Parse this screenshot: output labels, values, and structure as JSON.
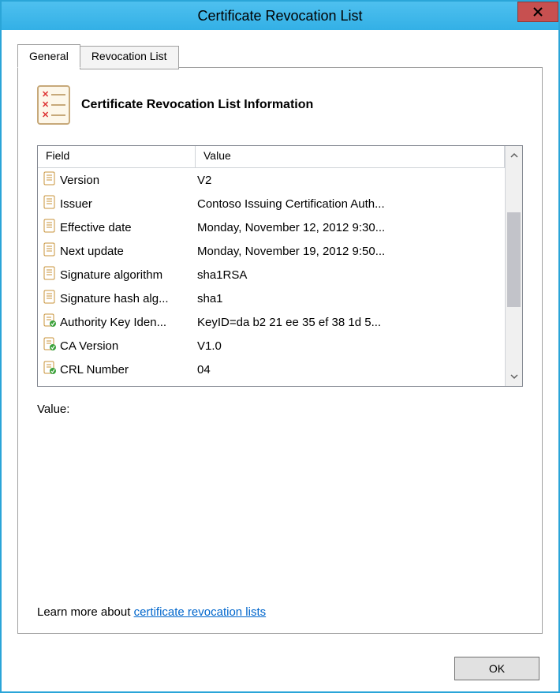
{
  "window": {
    "title": "Certificate Revocation List"
  },
  "tabs": {
    "general": "General",
    "revocation_list": "Revocation List"
  },
  "panel": {
    "title": "Certificate Revocation List Information",
    "columns": {
      "field": "Field",
      "value": "Value"
    },
    "rows": [
      {
        "icon": "doc",
        "field": "Version",
        "value": "V2"
      },
      {
        "icon": "doc",
        "field": "Issuer",
        "value": "Contoso Issuing Certification Auth..."
      },
      {
        "icon": "doc",
        "field": "Effective date",
        "value": "Monday, November 12, 2012 9:30..."
      },
      {
        "icon": "doc",
        "field": "Next update",
        "value": "Monday, November 19, 2012 9:50..."
      },
      {
        "icon": "doc",
        "field": "Signature algorithm",
        "value": "sha1RSA"
      },
      {
        "icon": "doc",
        "field": "Signature hash alg...",
        "value": "sha1"
      },
      {
        "icon": "ext",
        "field": "Authority Key Iden...",
        "value": "KeyID=da b2 21 ee 35 ef 38 1d 5..."
      },
      {
        "icon": "ext",
        "field": "CA Version",
        "value": "V1.0"
      },
      {
        "icon": "ext",
        "field": "CRL Number",
        "value": "04"
      }
    ],
    "value_label": "Value:",
    "learn_prefix": "Learn more about ",
    "learn_link": "certificate revocation lists"
  },
  "buttons": {
    "ok": "OK"
  }
}
